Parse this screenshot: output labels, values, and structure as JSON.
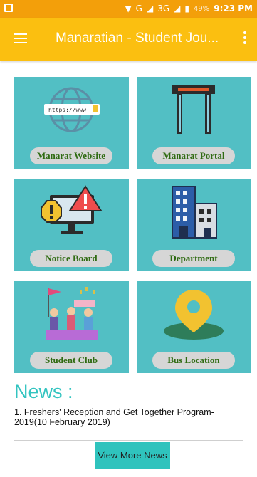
{
  "status_bar": {
    "network": "G",
    "network_2": "3G",
    "battery": "49%",
    "time": "9:23 PM"
  },
  "app_bar": {
    "title": "Manaratian - Student Jou..."
  },
  "tiles": [
    {
      "label": "Manarat Website",
      "icon": "globe-icon",
      "url_text": "https://www"
    },
    {
      "label": "Manarat Portal",
      "icon": "security-gate-icon"
    },
    {
      "label": "Notice Board",
      "icon": "alert-monitor-icon"
    },
    {
      "label": "Department",
      "icon": "building-icon"
    },
    {
      "label": "Student Club",
      "icon": "people-flag-icon"
    },
    {
      "label": "Bus Location",
      "icon": "map-pin-icon"
    }
  ],
  "news": {
    "heading": "News :",
    "items": [
      "1. Freshers' Reception and Get Together Program-2019(10 February 2019)"
    ],
    "more_label": "View More News"
  },
  "colors": {
    "status_bar": "#f39f0a",
    "app_bar": "#fbbf10",
    "tile": "#52bfc4",
    "label_pill": "#d6d6d6",
    "label_text": "#2f6b12",
    "news_heading": "#33c4c0",
    "button": "#2fc3bd"
  }
}
